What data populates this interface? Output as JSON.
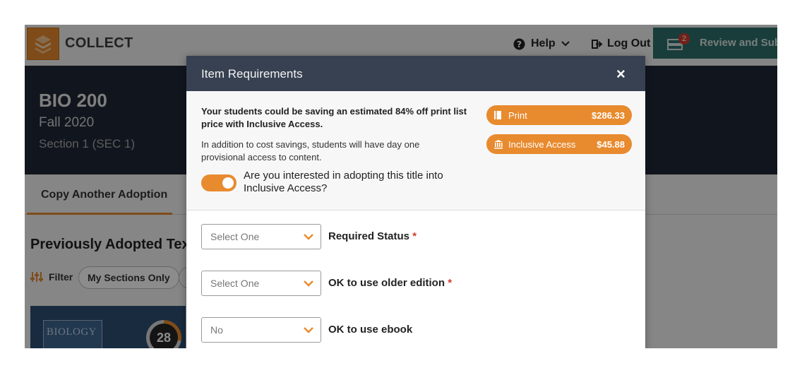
{
  "header": {
    "brand": "COLLECT",
    "help_label": "Help",
    "logout_label": "Log Out",
    "review_label": "Review and Subr",
    "review_badge": "2"
  },
  "course": {
    "code": "BIO 200",
    "term": "Fall 2020",
    "section": "Section 1 (SEC 1)"
  },
  "tabs": {
    "copy_adoption": "Copy Another Adoption"
  },
  "previous": {
    "title": "Previously Adopted Text",
    "filter_label": "Filter",
    "pill_label": "My Sections Only",
    "book_cover_text": "BIOLOGY",
    "book_count": "28"
  },
  "modal": {
    "title": "Item Requirements",
    "close": "×",
    "savings_text": "Your students could be saving an estimated 84% off print list price with Inclusive Access.",
    "access_text": "In addition to cost savings, students will have day one provisional access to content.",
    "print_label": "Print",
    "print_price": "$286.33",
    "ia_label": "Inclusive Access",
    "ia_price": "$45.88",
    "toggle_label": "Are you interested in adopting this title into Inclusive Access?",
    "toggle_on": true,
    "fields": [
      {
        "value": "Select One",
        "label": "Required Status",
        "required": "*"
      },
      {
        "value": "Select One",
        "label": "OK to use older edition",
        "required": "*"
      },
      {
        "value": "No",
        "label": "OK to use ebook",
        "required": ""
      }
    ]
  },
  "colors": {
    "accent": "#e88a2e",
    "header_dark": "#374151",
    "banner": "#1f2937",
    "review": "#2f6f6a"
  }
}
